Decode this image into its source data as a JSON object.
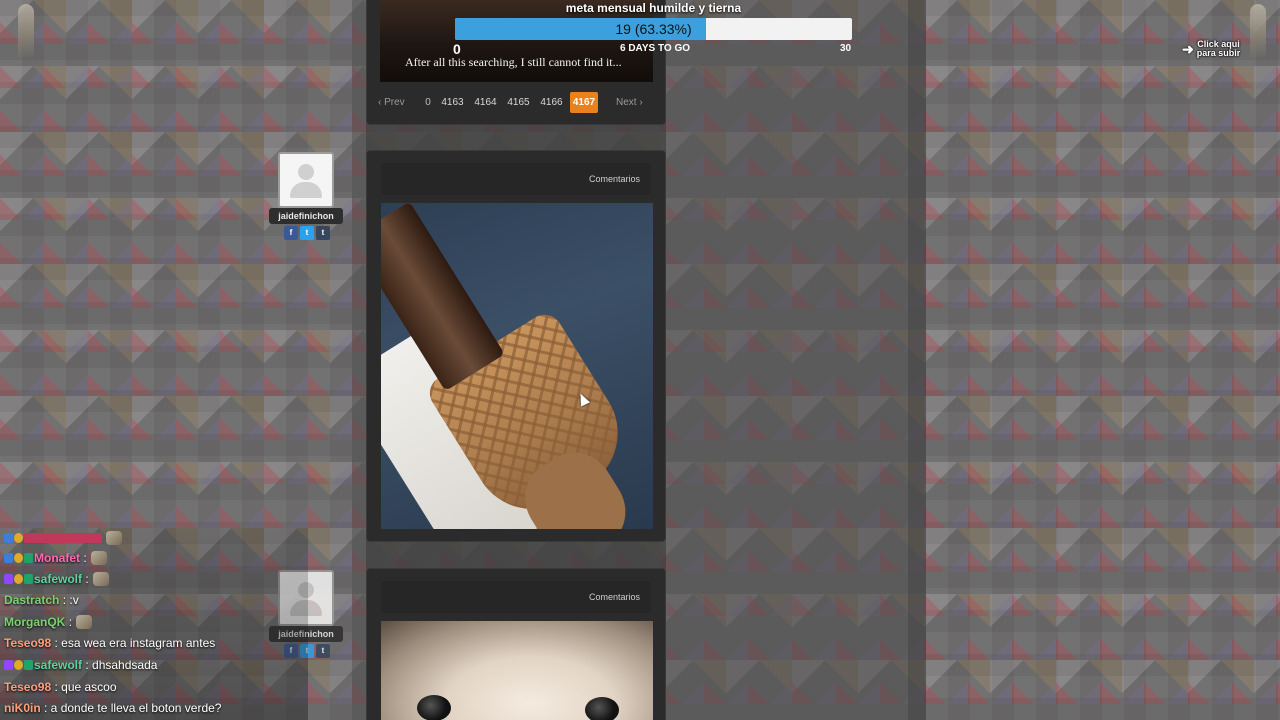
{
  "donation_goal": {
    "title": "meta mensual humilde y tierna",
    "progress_text": "19 (63.33%)",
    "progress_fraction": 0.6333,
    "min_label": "0",
    "days_left": "6 DAYS TO GO",
    "max_label": "30",
    "bar_color": "#3da0de"
  },
  "top_post": {
    "image_caption": "After all this searching, I still cannot find it..."
  },
  "pagination": {
    "prev_label": "‹ Prev",
    "pages": [
      "0",
      "4163",
      "4164",
      "4165",
      "4166",
      "4167"
    ],
    "active_page": "4167",
    "next_label": "Next ›",
    "active_color": "#e8821d"
  },
  "posts": [
    {
      "username": "jaidefinichon",
      "comments_label": "Comentarios"
    },
    {
      "username": "jaidefinichon",
      "comments_label": "Comentarios"
    }
  ],
  "social": {
    "facebook": "f",
    "twitter": "t",
    "tumblr": "t"
  },
  "chat": [
    {
      "user": "",
      "message": ""
    },
    {
      "user": "Monafet",
      "message": ":"
    },
    {
      "user": "safewolf",
      "message": ":"
    },
    {
      "user": "Dastratch",
      "message": ": :v"
    },
    {
      "user": "MorganQK",
      "message": ":"
    },
    {
      "user": "Teseo98",
      "message": ": esa wea era instagram antes"
    },
    {
      "user": "safewolf",
      "message": ": dhsahdsada"
    },
    {
      "user": "Teseo98",
      "message": ": que ascoo"
    },
    {
      "user": "niK0in",
      "message": ": a donde te lleva el boton verde?"
    }
  ],
  "chat_colors": {
    "Monafet": "#ff69b4",
    "safewolf": "#5fd3a0",
    "Dastratch": "#7ad46e",
    "MorganQK": "#7ad46e",
    "Teseo98": "#ff9e7a",
    "niK0in": "#ff9e7a"
  },
  "upload_widget": {
    "arrow": "➜",
    "line1": "Click aqui",
    "line2": "para subir"
  },
  "icons": {
    "prev": "chevron-left-icon",
    "next": "chevron-right-icon",
    "avatar": "user-placeholder-icon",
    "upload": "arrow-icon"
  }
}
